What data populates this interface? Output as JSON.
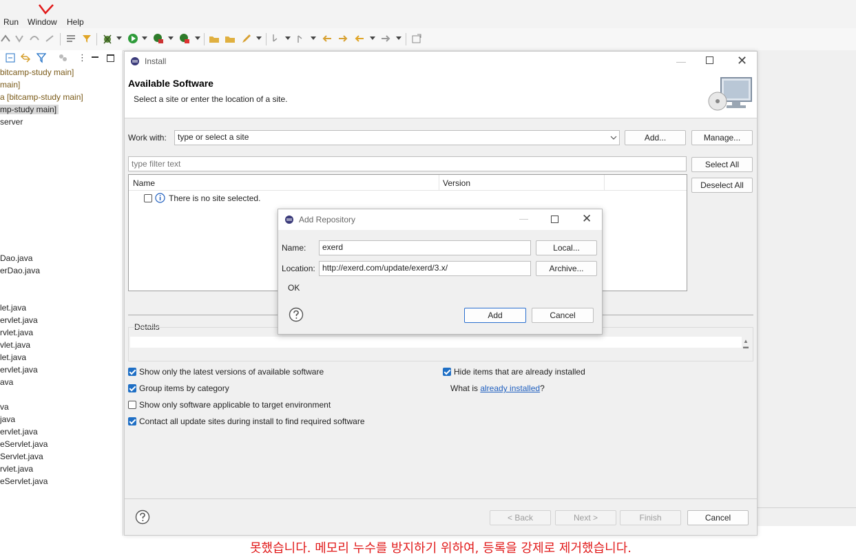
{
  "menubar": {
    "items": [
      "Run",
      "Window",
      "Help"
    ]
  },
  "left_panel": {
    "tree": [
      "bitcamp-study main]",
      "main]",
      "a [bitcamp-study main]",
      "mp-study main]",
      "server",
      "Dao.java",
      "erDao.java",
      "let.java",
      "ervlet.java",
      "rvlet.java",
      "vlet.java",
      "let.java",
      "ervlet.java",
      "ava",
      "va",
      "java",
      "ervlet.java",
      "eServlet.java",
      "Servlet.java",
      "rvlet.java",
      "eServlet.java"
    ]
  },
  "install": {
    "title": "Install",
    "heading": "Available Software",
    "subheading": "Select a site or enter the location of a site.",
    "work_with_label": "Work with:",
    "work_with_value": "type or select a site",
    "add_button": "Add...",
    "manage_button": "Manage...",
    "filter_placeholder": "type filter text",
    "select_all": "Select All",
    "deselect_all": "Deselect All",
    "col_name": "Name",
    "col_version": "Version",
    "no_site": "There is no site selected.",
    "details": "Details",
    "opt_latest": "Show only the latest versions of available software",
    "opt_group": "Group items by category",
    "opt_target": "Show only software applicable to target environment",
    "opt_contact": "Contact all update sites during install to find required software",
    "opt_hide": "Hide items that are already installed",
    "what_is": "What is ",
    "already_installed": "already installed",
    "question_end": "?",
    "back": "< Back",
    "next": "Next >",
    "finish": "Finish",
    "cancel": "Cancel"
  },
  "add_repository": {
    "title": "Add Repository",
    "name_label": "Name:",
    "name_value": "exerd",
    "location_label": "Location:",
    "location_value": "http://exerd.com/update/exerd/3.x/",
    "local_button": "Local...",
    "archive_button": "Archive...",
    "status": "OK",
    "add_button": "Add",
    "cancel_button": "Cancel"
  },
  "console": {
    "line1": "못했습니다. 메모리 누수를 방지하기 위하여, 등록을 강제로 제거했습니다."
  },
  "colors": {
    "accent": "#1f6fc5",
    "link": "#1f5fbf",
    "console_red": "#e11919"
  }
}
